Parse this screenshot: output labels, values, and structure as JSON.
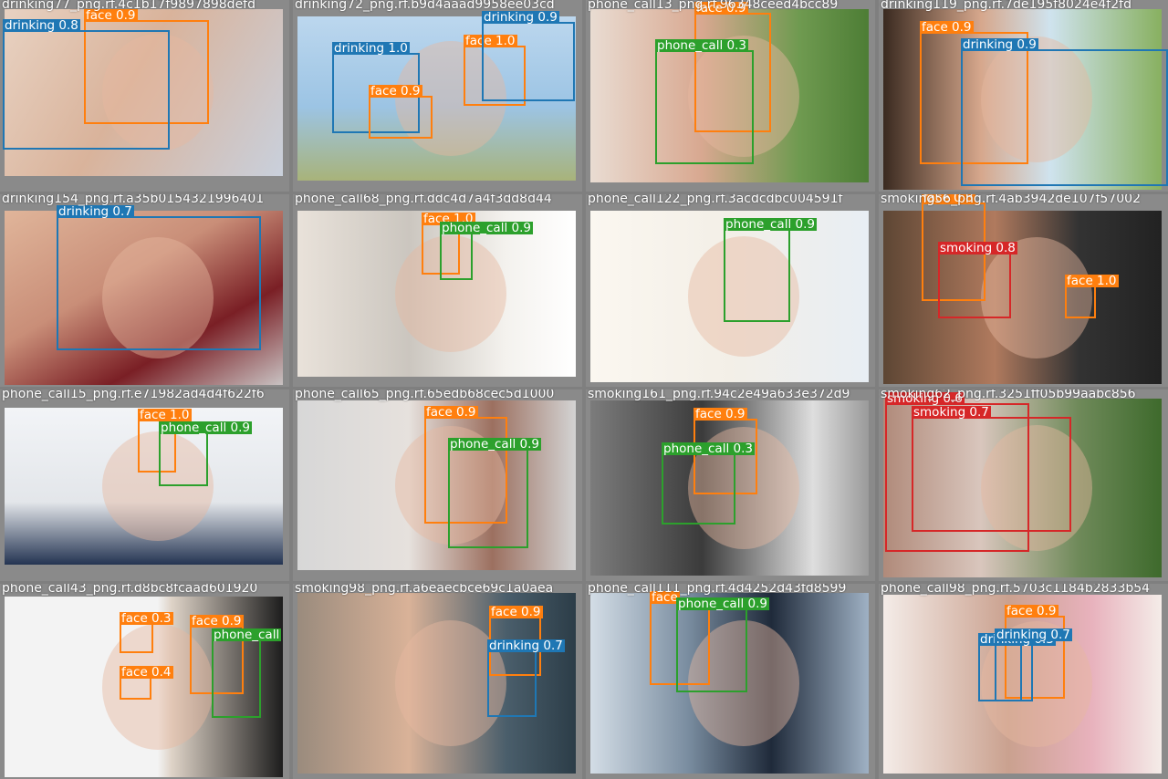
{
  "colors": {
    "face": "#ff7f0e",
    "drinking": "#1f77b4",
    "phone_call": "#2ca02c",
    "smoking": "#d62728"
  },
  "cells": [
    {
      "file": "drinking77_png.rf.4c1b17f9897898defd",
      "dets": [
        {
          "cls": "face",
          "conf": "0.9"
        },
        {
          "cls": "drinking",
          "conf": "0.8"
        }
      ]
    },
    {
      "file": "drinking72_png.rf.b9d4aaad9958ee03cd",
      "dets": [
        {
          "cls": "drinking",
          "conf": "1.0"
        },
        {
          "cls": "face",
          "conf": "0.9"
        },
        {
          "cls": "face",
          "conf": "1.0"
        },
        {
          "cls": "drinking",
          "conf": "0.9"
        }
      ]
    },
    {
      "file": "phone_call13_png.rf.96348ceed4bcc89",
      "dets": [
        {
          "cls": "face",
          "conf": "0.9"
        },
        {
          "cls": "phone_call",
          "conf": "0.3"
        }
      ]
    },
    {
      "file": "drinking119_png.rf.7de195f8024e4f2fd",
      "dets": [
        {
          "cls": "face",
          "conf": "0.9"
        },
        {
          "cls": "drinking",
          "conf": "0.9"
        }
      ]
    },
    {
      "file": "drinking154_png.rf.a35b0154321996401",
      "dets": [
        {
          "cls": "drinking",
          "conf": "0.7"
        }
      ]
    },
    {
      "file": "phone_call68_png.rf.ddc4d7a4f3dd8d44",
      "dets": [
        {
          "cls": "face",
          "conf": "1.0"
        },
        {
          "cls": "phone_call",
          "conf": "0.9"
        }
      ]
    },
    {
      "file": "phone_call122_png.rf.3acdcdbc004591f",
      "dets": [
        {
          "cls": "phone_call",
          "conf": "0.9"
        }
      ]
    },
    {
      "file": "smoking56_png.rf.4ab3942de107f57002",
      "dets": [
        {
          "cls": "face",
          "conf": "0.8"
        },
        {
          "cls": "smoking",
          "conf": "0.8"
        },
        {
          "cls": "face",
          "conf": "1.0"
        }
      ]
    },
    {
      "file": "phone_call15_png.rf.e71982ad4d4f622f6",
      "dets": [
        {
          "cls": "face",
          "conf": "1.0"
        },
        {
          "cls": "phone_call",
          "conf": "0.9"
        }
      ]
    },
    {
      "file": "phone_call65_png.rf.65edb68cec5d1000",
      "dets": [
        {
          "cls": "face",
          "conf": "0.9"
        },
        {
          "cls": "phone_call",
          "conf": "0.9"
        }
      ]
    },
    {
      "file": "smoking161_png.rf.94c2e49a633e372d9",
      "dets": [
        {
          "cls": "face",
          "conf": "0.9"
        },
        {
          "cls": "phone_call",
          "conf": "0.3"
        }
      ]
    },
    {
      "file": "smoking62_png.rf.3251ff05b99aabc856",
      "dets": [
        {
          "cls": "smoking",
          "conf": "0.6"
        },
        {
          "cls": "smoking",
          "conf": "0.7"
        }
      ]
    },
    {
      "file": "phone_call43_png.rf.d8bc8fcaad601920",
      "dets": [
        {
          "cls": "face",
          "conf": "0.3"
        },
        {
          "cls": "face",
          "conf": "0.9"
        },
        {
          "cls": "phone_call",
          "conf": ""
        },
        {
          "cls": "face",
          "conf": "0.4"
        }
      ]
    },
    {
      "file": "smoking98_png.rf.a6eaecbce69c1a0aea",
      "dets": [
        {
          "cls": "face",
          "conf": "0.9"
        },
        {
          "cls": "drinking",
          "conf": "0.7"
        }
      ]
    },
    {
      "file": "phone_call111_png.rf.4d4252d43fd8599",
      "dets": [
        {
          "cls": "face",
          "conf": ""
        },
        {
          "cls": "phone_call",
          "conf": "0.9"
        }
      ]
    },
    {
      "file": "phone_call98_png.rf.5703c1184b2833b54",
      "dets": [
        {
          "cls": "face",
          "conf": "0.9"
        },
        {
          "cls": "drinking",
          "conf": "0.3"
        },
        {
          "cls": "drinking",
          "conf": "0.7"
        }
      ]
    }
  ]
}
